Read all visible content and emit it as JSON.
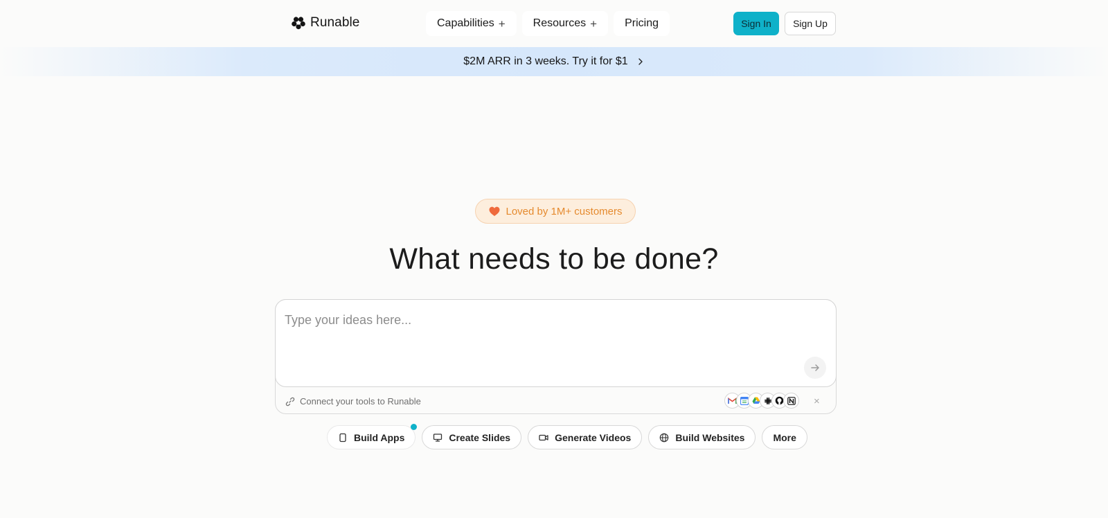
{
  "brand": {
    "name": "Runable"
  },
  "nav": {
    "items": [
      {
        "label": "Capabilities",
        "has_plus": true
      },
      {
        "label": "Resources",
        "has_plus": true
      },
      {
        "label": "Pricing",
        "has_plus": false
      }
    ],
    "plus_glyph": "+"
  },
  "auth": {
    "sign_in": "Sign In",
    "sign_up": "Sign Up",
    "accent": "#0fb1c9"
  },
  "banner": {
    "text": "$2M ARR in 3 weeks. Try it for $1",
    "icon": "chevron-right-icon"
  },
  "hero": {
    "badge": "Loved by 1M+ customers",
    "badge_icon": "heart-icon",
    "title": "What needs to be done?"
  },
  "prompt": {
    "placeholder": "Type your ideas here...",
    "value": "",
    "connect_text": "Connect your tools to Runable",
    "tools": [
      "gmail-icon",
      "google-calendar-icon",
      "google-drive-icon",
      "slack-icon",
      "github-icon",
      "notion-icon"
    ],
    "close_glyph": "×"
  },
  "chips": [
    {
      "label": "Build Apps",
      "icon": "phone-icon",
      "active": true
    },
    {
      "label": "Create Slides",
      "icon": "presentation-icon",
      "active": false
    },
    {
      "label": "Generate Videos",
      "icon": "video-icon",
      "active": false
    },
    {
      "label": "Build Websites",
      "icon": "globe-icon",
      "active": false
    },
    {
      "label": "More",
      "icon": "",
      "active": false
    }
  ]
}
